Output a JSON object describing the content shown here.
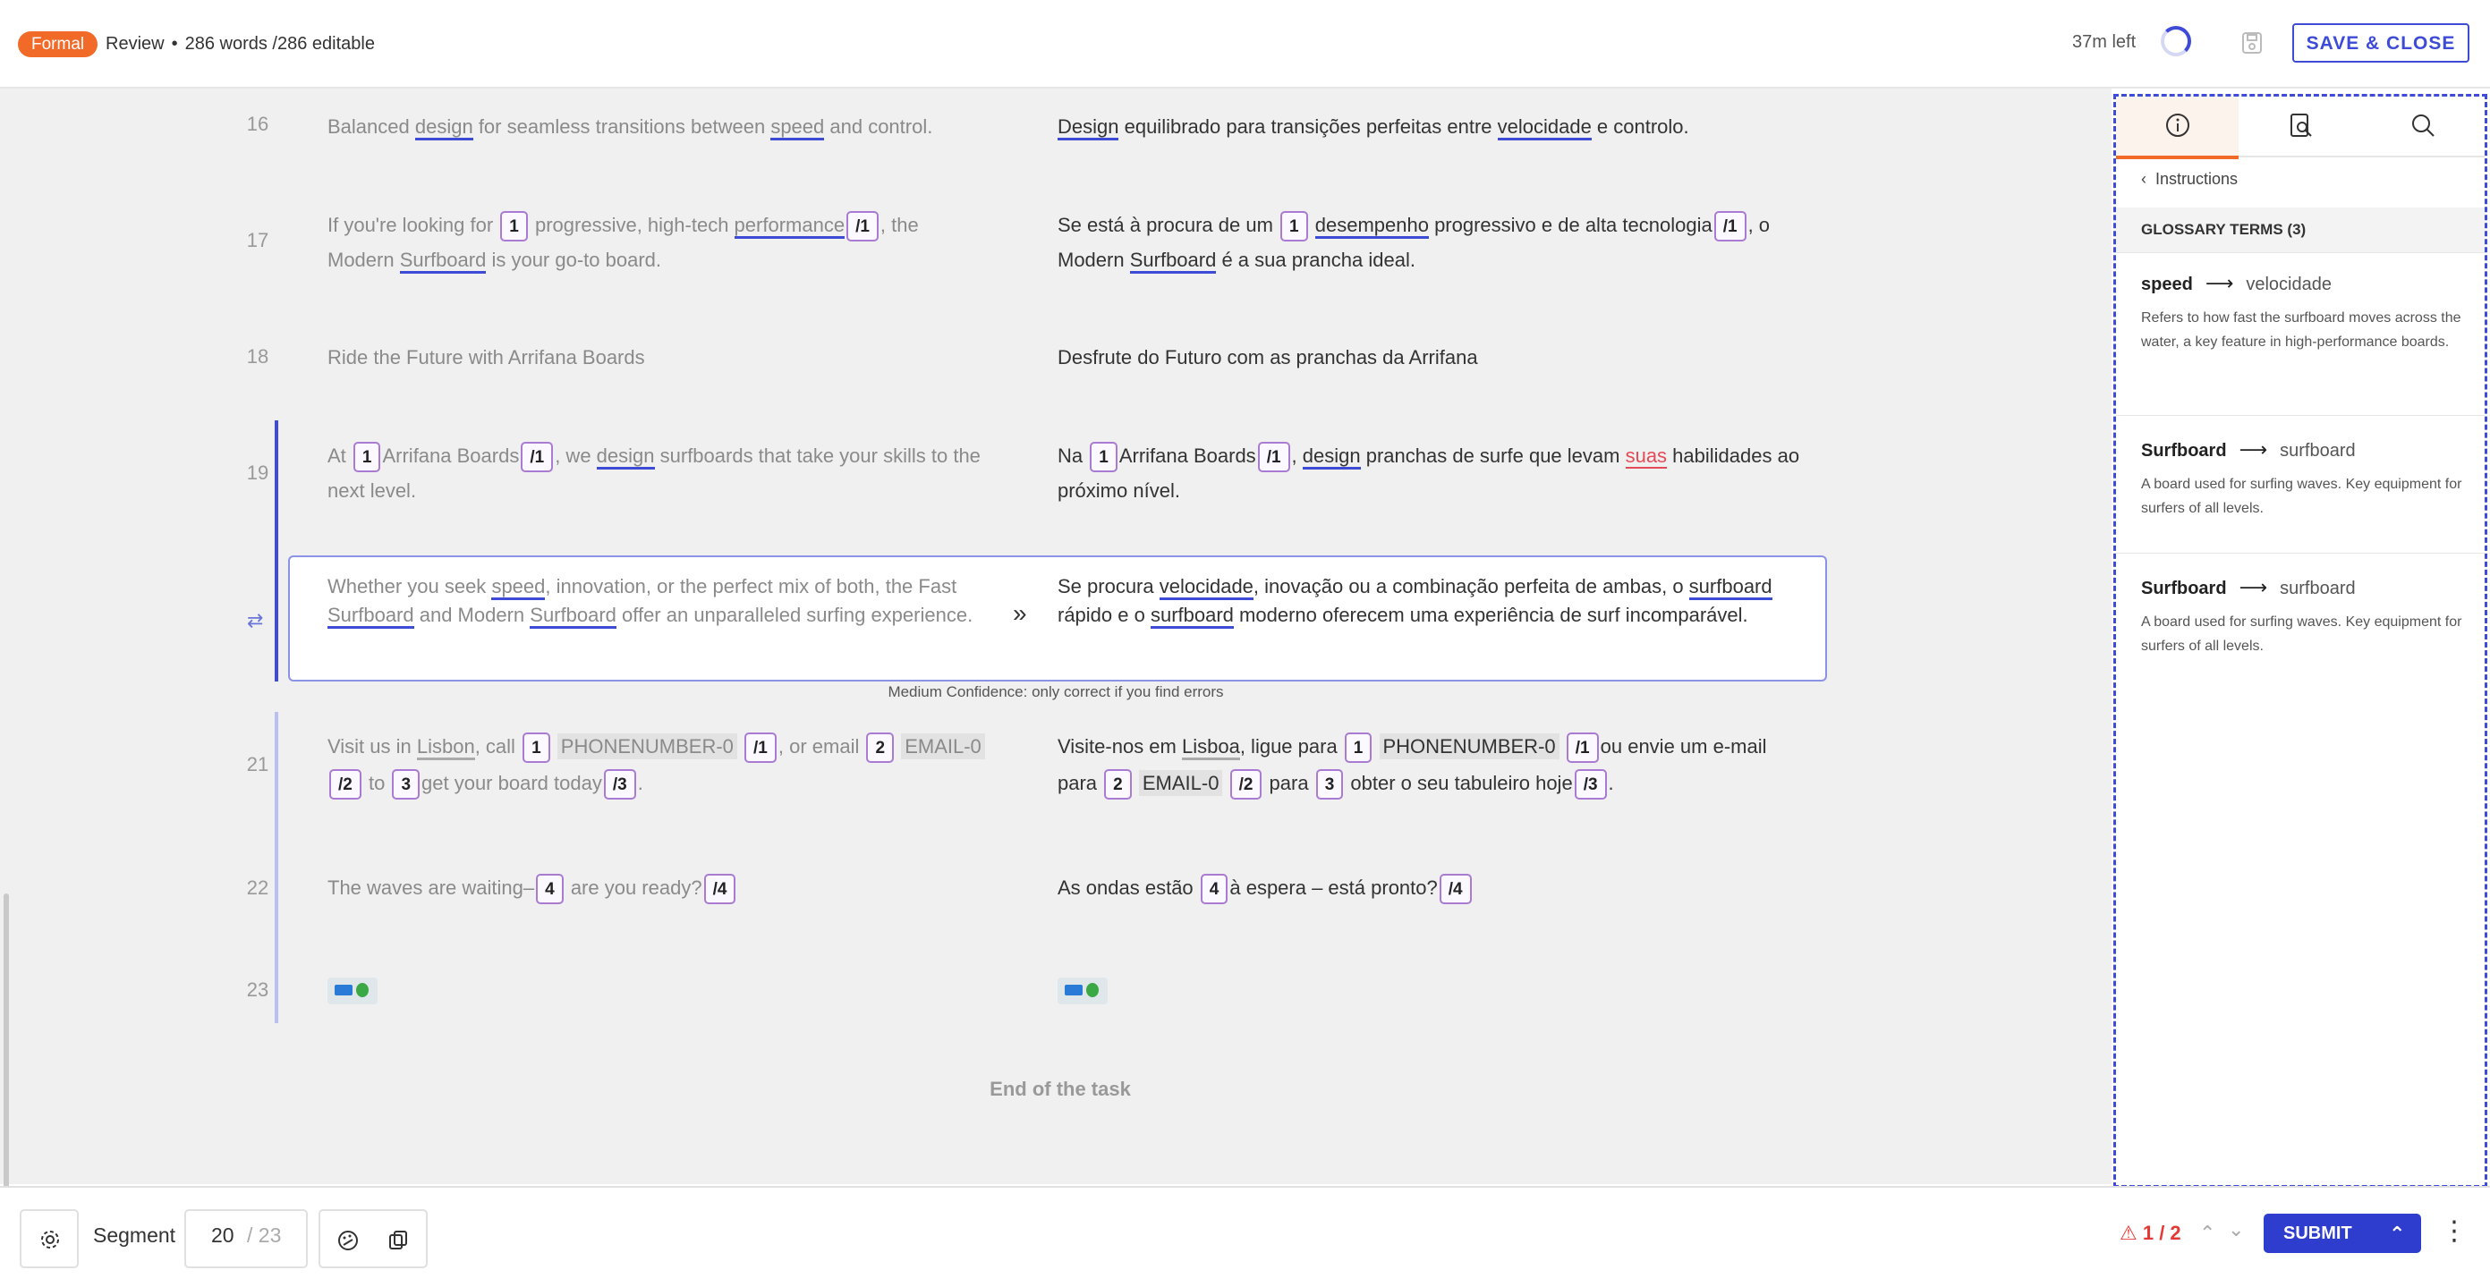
{
  "header": {
    "badge": "Formal",
    "mode": "Review",
    "words": "286 words /286 editable",
    "time_left": "37m left",
    "save_close": "SAVE & CLOSE"
  },
  "segments": {
    "s16": {
      "num": "16"
    },
    "s17": {
      "num": "17"
    },
    "s18": {
      "num": "18",
      "src": "Ride the Future with Arrifana Boards",
      "tgt": "Desfrute do Futuro com as pranchas da Arrifana"
    },
    "s19": {
      "num": "19"
    },
    "s21": {
      "num": "21"
    },
    "s22": {
      "num": "22"
    },
    "s23": {
      "num": "23"
    }
  },
  "confidence_note": "Medium Confidence: only correct if you find errors",
  "end_of_task": "End of the task",
  "panel": {
    "instructions_link": "Instructions",
    "glossary_heading": "GLOSSARY TERMS (3)",
    "terms": [
      {
        "term": "speed",
        "translation": "velocidade",
        "description": "Refers to how fast the surfboard moves across the water, a key feature in high-performance boards."
      },
      {
        "term": "Surfboard",
        "translation": "surfboard",
        "description": "A board used for surfing waves. Key equipment for surfers of all levels."
      },
      {
        "term": "Surfboard",
        "translation": "surfboard",
        "description": "A board used for surfing waves. Key equipment for surfers of all levels."
      }
    ]
  },
  "footer": {
    "segment_label": "Segment",
    "current": "20",
    "total": "/ 23",
    "issues": "1 / 2",
    "submit": "SUBMIT"
  },
  "colors": {
    "accent": "#3d4bd6",
    "badge": "#f26a28",
    "tag_border": "#a97bd3",
    "error": "#e54a57"
  }
}
